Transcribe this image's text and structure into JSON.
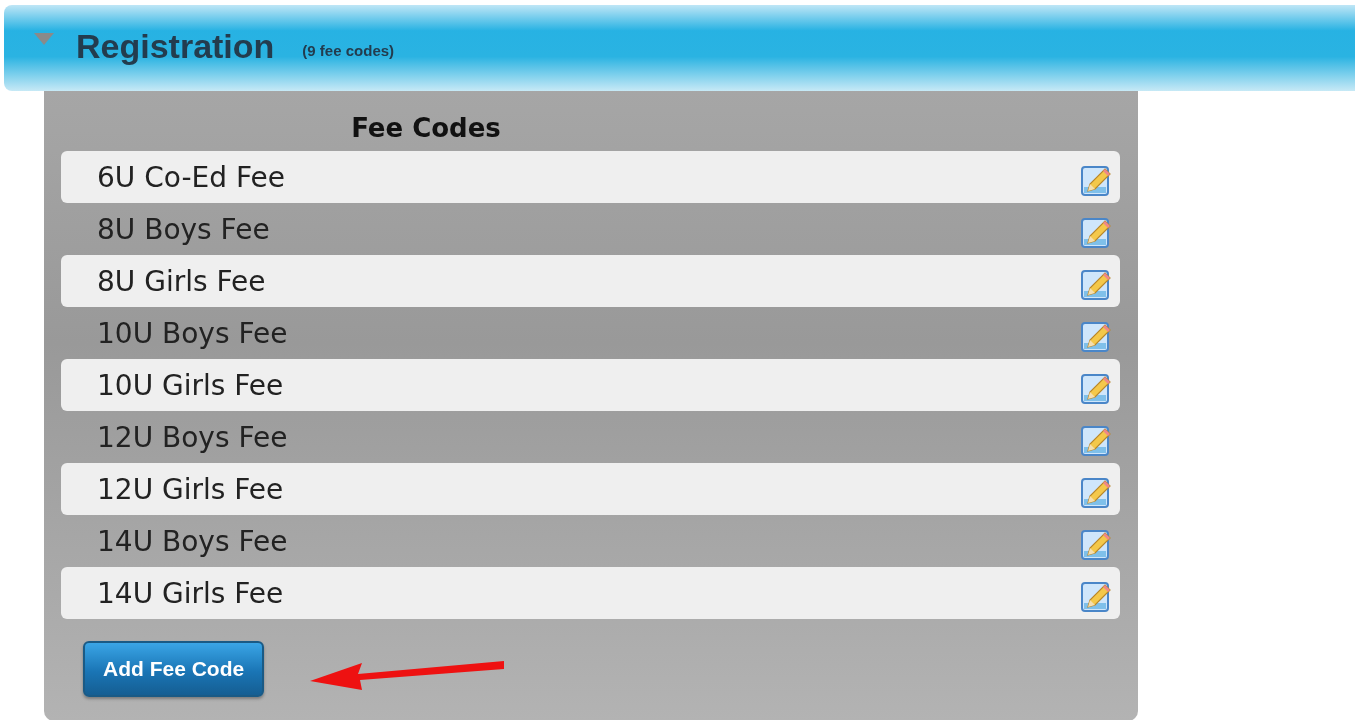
{
  "section": {
    "title": "Registration",
    "count": "(9 fee codes)",
    "expanded": true
  },
  "table": {
    "heading": "Fee Codes",
    "rows": [
      {
        "name": "6U Co-Ed Fee"
      },
      {
        "name": "8U Boys Fee"
      },
      {
        "name": "8U Girls Fee"
      },
      {
        "name": "10U Boys Fee"
      },
      {
        "name": "10U Girls Fee"
      },
      {
        "name": "12U Boys Fee"
      },
      {
        "name": "12U Girls Fee"
      },
      {
        "name": "14U Boys Fee"
      },
      {
        "name": "14U Girls Fee"
      }
    ]
  },
  "add_button": "Add Fee Code"
}
